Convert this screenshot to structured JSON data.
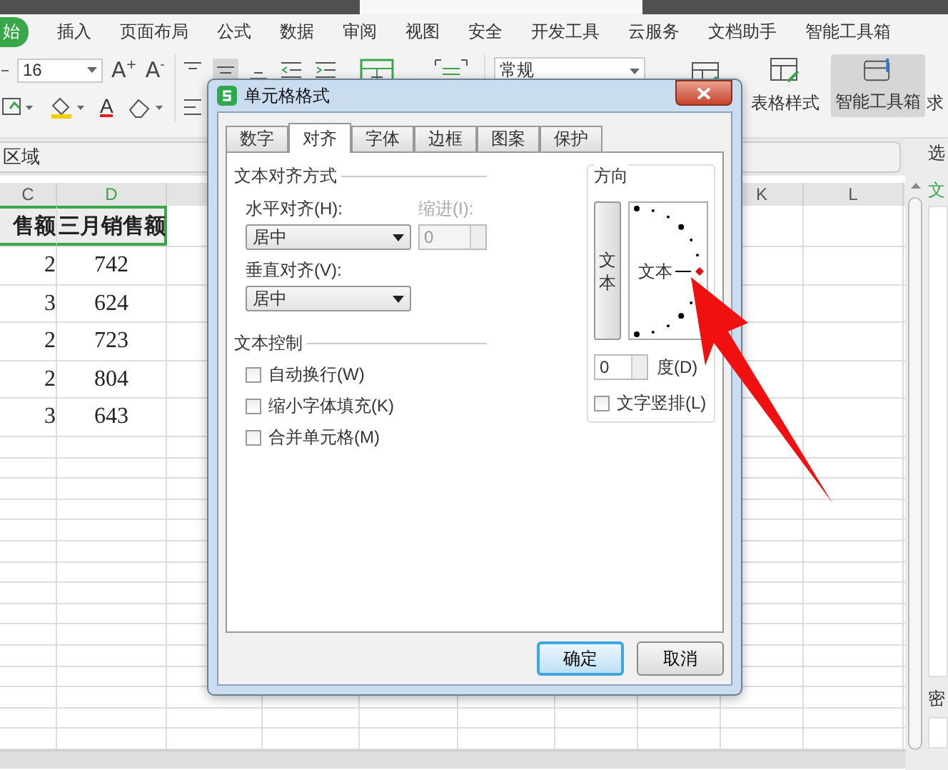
{
  "menu_tabs": [
    {
      "label": "始",
      "selected": true
    },
    {
      "label": "插入",
      "selected": false
    },
    {
      "label": "页面布局",
      "selected": false
    },
    {
      "label": "公式",
      "selected": false
    },
    {
      "label": "数据",
      "selected": false
    },
    {
      "label": "审阅",
      "selected": false
    },
    {
      "label": "视图",
      "selected": false
    },
    {
      "label": "安全",
      "selected": false
    },
    {
      "label": "开发工具",
      "selected": false
    },
    {
      "label": "云服务",
      "selected": false
    },
    {
      "label": "文档助手",
      "selected": false
    },
    {
      "label": "智能工具箱",
      "selected": false
    }
  ],
  "toolbar": {
    "font_size": "16",
    "grow_font": "A$^{+}$",
    "shrink_font": "A$^{-}$",
    "font_color": "A",
    "number_format": "常规",
    "table_style": "表格样式",
    "smart_toolbox": "智能工具箱",
    "smart_toolbox_active": true,
    "cut_label": "求"
  },
  "name_box": "区域",
  "sheet": {
    "columns": [
      {
        "label": "C"
      },
      {
        "label": "D"
      },
      {
        "label": "K"
      },
      {
        "label": "L"
      }
    ],
    "rows": [
      {
        "cells": [
          "售额",
          "三月销售额"
        ],
        "kind": "header",
        "selected": true
      },
      {
        "cells": [
          "2",
          "742"
        ],
        "kind": "data",
        "selected": false
      },
      {
        "cells": [
          "3",
          "624"
        ],
        "kind": "data",
        "selected": false
      },
      {
        "cells": [
          "2",
          "723"
        ],
        "kind": "data",
        "selected": false
      },
      {
        "cells": [
          "2",
          "804"
        ],
        "kind": "data",
        "selected": false
      },
      {
        "cells": [
          "3",
          "643"
        ],
        "kind": "data",
        "selected": false
      }
    ]
  },
  "side_pane": {
    "top_label": "选",
    "green_label": "文",
    "bottom_label": "密"
  },
  "dialog": {
    "title": "单元格格式",
    "tabs": [
      {
        "label": "数字",
        "selected": false
      },
      {
        "label": "对齐",
        "selected": true
      },
      {
        "label": "字体",
        "selected": false
      },
      {
        "label": "边框",
        "selected": false
      },
      {
        "label": "图案",
        "selected": false
      },
      {
        "label": "保护",
        "selected": false
      }
    ],
    "alignment": {
      "section": "文本对齐方式",
      "horizontal_label": "水平对齐(H):",
      "horizontal_value": "居中",
      "indent_label": "缩进(I):",
      "indent_value": "0",
      "indent_disabled": true,
      "vertical_label": "垂直对齐(V):",
      "vertical_value": "居中"
    },
    "control": {
      "section": "文本控制",
      "options": [
        {
          "label": "自动换行(W)",
          "checked": false
        },
        {
          "label": "缩小字体填充(K)",
          "checked": false
        },
        {
          "label": "合并单元格(M)",
          "checked": false
        }
      ]
    },
    "orientation": {
      "section": "方向",
      "vertical_text": "文本",
      "dial_text": "文本",
      "degrees": "0",
      "degrees_label": "度(D)",
      "stack_label": "文字竖排(L)",
      "stack_checked": false
    },
    "buttons": [
      {
        "label": "确定",
        "default": true
      },
      {
        "label": "取消",
        "default": false
      }
    ]
  }
}
